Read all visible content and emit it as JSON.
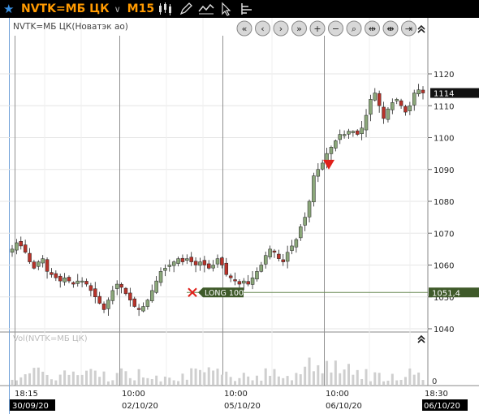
{
  "toolbar": {
    "symbol": "NVTK=МБ ЦК",
    "timeframe": "M15",
    "icons": [
      "star-icon",
      "chevron-down-icon",
      "candles-icon",
      "pencil-icon",
      "indicator-icon",
      "cursor-icon",
      "object-list-icon"
    ]
  },
  "price_panel": {
    "title": "NVTK=МБ ЦК(Новатэк ао)",
    "y_ticks": [
      "1120",
      "1110",
      "1100",
      "1090",
      "1080",
      "1070",
      "1060",
      "1050",
      "1040"
    ],
    "last_price": "1114",
    "order_price": "1051,4",
    "order_label": "LONG 100",
    "nav_buttons": [
      "scroll-start",
      "scroll-left",
      "scroll-right",
      "scroll-end",
      "zoom-in",
      "zoom-out",
      "zoom-fit",
      "compress",
      "expand",
      "reset",
      "collapse"
    ]
  },
  "volume_panel": {
    "title": "Vol(NVTK=МБ ЦК)",
    "y_tick": "0"
  },
  "time_axis": {
    "times": [
      "18:15",
      "10:00",
      "10:00",
      "10:00",
      "18:30"
    ],
    "dates": [
      "30/09/20",
      "02/10/20",
      "05/10/20",
      "06/10/20",
      "06/10/20"
    ]
  },
  "colors": {
    "up": "#8ba77a",
    "down": "#b8332a",
    "accent": "#ff9a00",
    "order_line": "#3f5a2a",
    "signal": "#e0201a"
  },
  "chart_data": {
    "type": "candlestick",
    "ylim": [
      1037,
      1126
    ],
    "closes": [
      1065,
      1067,
      1066,
      1064,
      1061,
      1059,
      1061,
      1062,
      1058,
      1057,
      1056,
      1055,
      1056,
      1055,
      1054,
      1055,
      1055,
      1054,
      1052,
      1050,
      1048,
      1046,
      1049,
      1052,
      1054,
      1053,
      1051,
      1049,
      1047,
      1046,
      1047,
      1049,
      1052,
      1055,
      1058,
      1059,
      1060,
      1061,
      1062,
      1061,
      1062,
      1061,
      1060,
      1061,
      1060,
      1059,
      1060,
      1062,
      1060,
      1057,
      1056,
      1055,
      1054,
      1055,
      1054,
      1056,
      1058,
      1060,
      1063,
      1065,
      1064,
      1062,
      1061,
      1064,
      1066,
      1068,
      1072,
      1075,
      1080,
      1088,
      1090,
      1092,
      1095,
      1097,
      1099,
      1101,
      1101,
      1102,
      1102,
      1101,
      1103,
      1107,
      1112,
      1114,
      1110,
      1106,
      1109,
      1111,
      1112,
      1110,
      1108,
      1110,
      1114,
      1115,
      1114
    ]
  }
}
